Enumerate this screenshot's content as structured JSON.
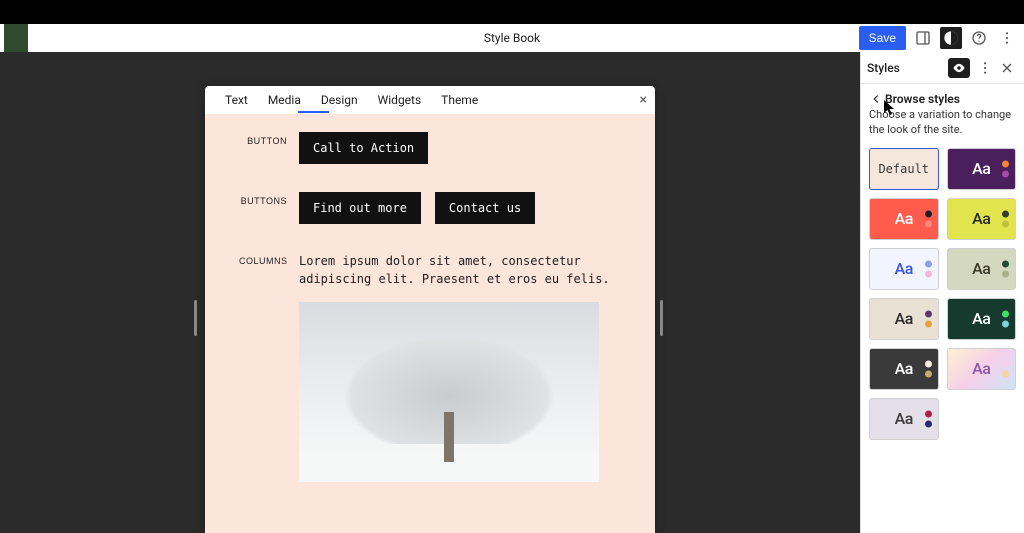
{
  "header": {
    "title": "Style Book",
    "save_label": "Save"
  },
  "preview": {
    "tabs": [
      "Text",
      "Media",
      "Design",
      "Widgets",
      "Theme"
    ],
    "active_tab_index": 2,
    "blocks": {
      "button": {
        "label": "BUTTON",
        "cta": "Call to Action"
      },
      "buttons": {
        "label": "BUTTONS",
        "a": "Find out more",
        "b": "Contact us"
      },
      "columns": {
        "label": "COLUMNS",
        "lorem": "Lorem ipsum dolor sit amet, consectetur adipiscing elit. Praesent et eros eu felis."
      }
    }
  },
  "styles_panel": {
    "title": "Styles",
    "browse_title": "Browse styles",
    "description": "Choose a variation to change the look of the site.",
    "variations": [
      {
        "bg": "#f5e7db",
        "text": "#3a3a3a",
        "default": true,
        "label": "Default",
        "dots": []
      },
      {
        "bg": "#4b1e5c",
        "text": "#ffffff",
        "label": "Aa",
        "dots": [
          "#f0863a",
          "#a84aa8"
        ]
      },
      {
        "bg": "#ff5c4d",
        "text": "#ffffff",
        "label": "Aa",
        "dots": [
          "#1e1e1e",
          "#ff8a7a"
        ]
      },
      {
        "bg": "#e1e44c",
        "text": "#2b2b2b",
        "label": "Aa",
        "dots": [
          "#3a3a2b",
          "#c0c33a"
        ]
      },
      {
        "bg": "#f2f5ff",
        "text": "#3a56e0",
        "label": "Aa",
        "dots": [
          "#8aa0ee",
          "#f7b7d6"
        ]
      },
      {
        "bg": "#d3d8be",
        "text": "#3a3a2b",
        "label": "Aa",
        "dots": [
          "#244b2f",
          "#a9b08e"
        ]
      },
      {
        "bg": "#e9e1d4",
        "text": "#2b2b2b",
        "label": "Aa",
        "dots": [
          "#5a3a6b",
          "#e6a23a"
        ]
      },
      {
        "bg": "#163a2e",
        "text": "#ffffff",
        "label": "Aa",
        "dots": [
          "#3fe06a",
          "#7ad6d6"
        ]
      },
      {
        "bg": "#3a3a3a",
        "text": "#ffffff",
        "label": "Aa",
        "dots": [
          "#f6eedd",
          "#c7a971"
        ]
      },
      {
        "bg": "linear-gradient(135deg,#fff1d1,#f6cfe9,#cfe4f6)",
        "text": "#8a5aa8",
        "label": "Aa",
        "dots": [
          "#f6cfe9",
          "#f4d6a0"
        ]
      },
      {
        "bg": "#e3e0ea",
        "text": "#3a3a3a",
        "label": "Aa",
        "dots": [
          "#b01e4a",
          "#2b2b6b"
        ]
      }
    ]
  }
}
